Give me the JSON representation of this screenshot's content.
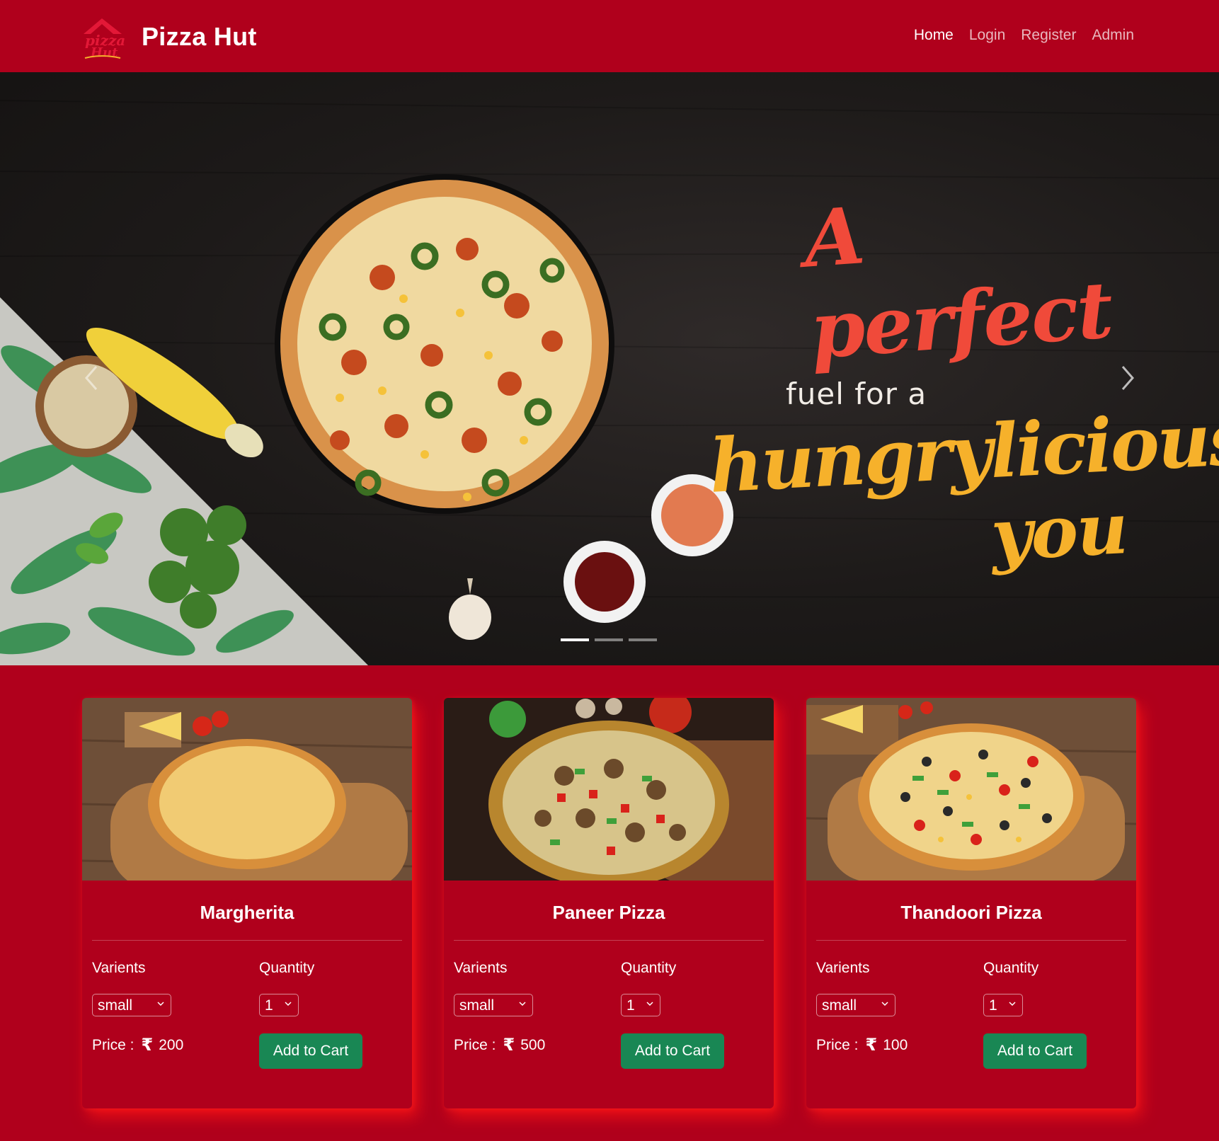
{
  "navbar": {
    "brand": "Pizza Hut",
    "links": [
      {
        "label": "Home",
        "active": true
      },
      {
        "label": "Login",
        "active": false
      },
      {
        "label": "Register",
        "active": false
      },
      {
        "label": "Admin",
        "active": false
      }
    ]
  },
  "hero": {
    "line1": "A perfect",
    "line2": "fuel for a",
    "line3": "hungrylicious",
    "line4": "you",
    "active_slide": 1,
    "slide_count": 3
  },
  "products": [
    {
      "name": "Margherita",
      "variants_label": "Varients",
      "quantity_label": "Quantity",
      "variant": "small",
      "quantity": "1",
      "price_label": "Price :",
      "currency": "₹",
      "price": "200",
      "button": "Add to Cart"
    },
    {
      "name": "Paneer Pizza",
      "variants_label": "Varients",
      "quantity_label": "Quantity",
      "variant": "small",
      "quantity": "1",
      "price_label": "Price :",
      "currency": "₹",
      "price": "500",
      "button": "Add to Cart"
    },
    {
      "name": "Thandoori Pizza",
      "variants_label": "Varients",
      "quantity_label": "Quantity",
      "variant": "small",
      "quantity": "1",
      "price_label": "Price :",
      "currency": "₹",
      "price": "100",
      "button": "Add to Cart"
    }
  ],
  "colors": {
    "brand_red": "#b0001c",
    "button_green": "#198754",
    "tagline_red": "#f04a3a",
    "tagline_yellow": "#f6b12b"
  }
}
